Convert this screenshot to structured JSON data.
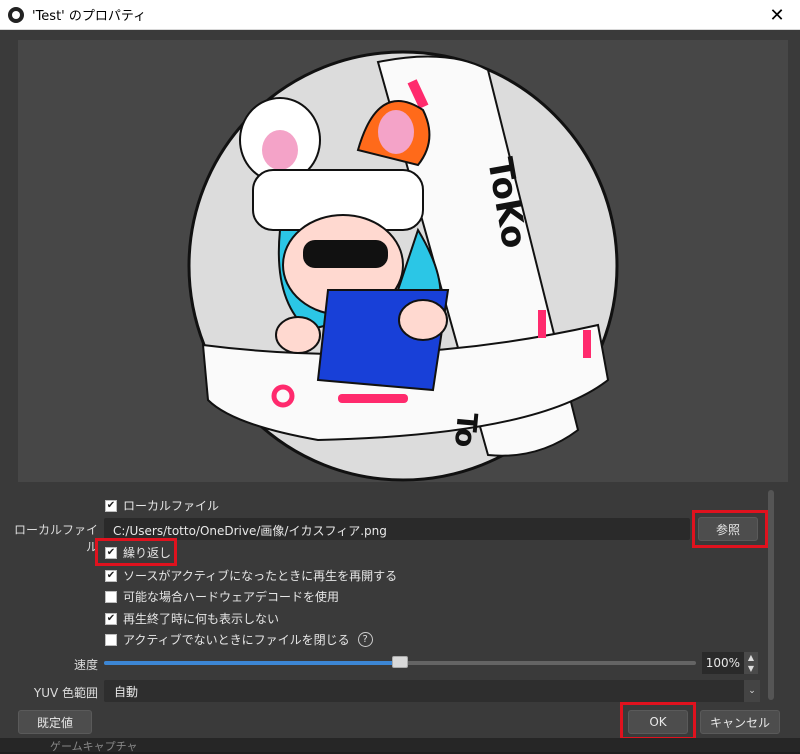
{
  "window": {
    "title": "'Test' のプロパティ",
    "close_glyph": "✕"
  },
  "preview": {
    "image_text_top": "ToKo",
    "image_text_bottom": "To"
  },
  "local_file_checkbox": {
    "label": "ローカルファイル",
    "checked": true
  },
  "local_file": {
    "label": "ローカルファイル",
    "value": "C:/Users/totto/OneDrive/画像/イカスフィア.png",
    "browse_label": "参照"
  },
  "options": [
    {
      "label": "繰り返し",
      "checked": true
    },
    {
      "label": "ソースがアクティブになったときに再生を再開する",
      "checked": true
    },
    {
      "label": "可能な場合ハードウェアデコードを使用",
      "checked": false
    },
    {
      "label": "再生終了時に何も表示しない",
      "checked": true
    },
    {
      "label": "アクティブでないときにファイルを閉じる",
      "checked": false
    }
  ],
  "help_glyph": "?",
  "speed": {
    "label": "速度",
    "value_text": "100%",
    "level_fraction": 0.5
  },
  "yuv": {
    "label": "YUV 色範囲",
    "value": "自動"
  },
  "footer": {
    "defaults_label": "既定値",
    "ok_label": "OK",
    "cancel_label": "キャンセル"
  },
  "background_strip": {
    "text": "ゲームキャプチャ"
  },
  "colors": {
    "accent": "#3c86d4",
    "highlight": "#e0121e",
    "bg": "#3a3a3a"
  }
}
